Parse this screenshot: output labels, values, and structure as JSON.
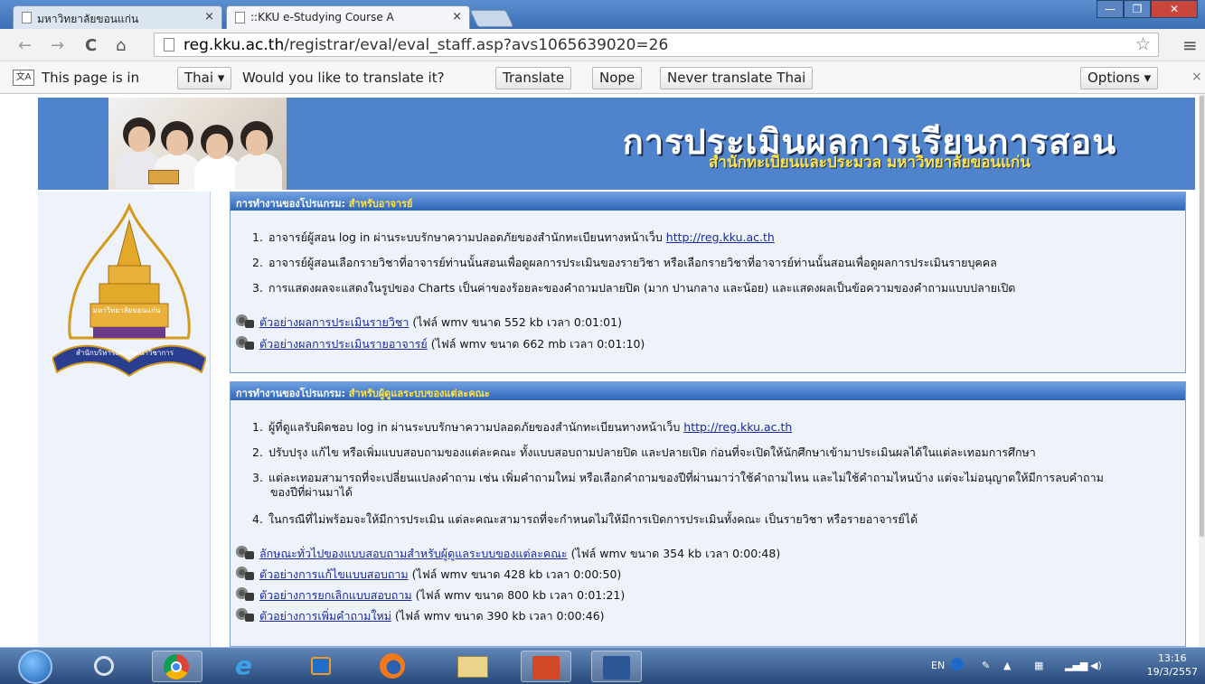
{
  "browser": {
    "tabs": [
      {
        "label": "มหาวิทยาลัยขอนแก่น",
        "close": "×"
      },
      {
        "label": "::KKU e-Studying Course A",
        "close": "×"
      }
    ],
    "window_buttons": {
      "minimize": "—",
      "maximize": "❐",
      "close": "✕"
    },
    "nav": {
      "back": "←",
      "forward": "→",
      "reload": "C",
      "home": "⌂",
      "star": "☆",
      "menu": "≡"
    },
    "url_host": "reg.kku.ac.th",
    "url_path": "/registrar/eval/eval_staff.asp?avs1065639020=26"
  },
  "translate_bar": {
    "prefix": "This page is in",
    "language": "Thai",
    "question": "Would you like to translate it?",
    "translate_btn": "Translate",
    "nope_btn": "Nope",
    "never_btn": "Never translate Thai",
    "options_btn": "Options",
    "close": "×"
  },
  "banner": {
    "title": "การประเมินผลการเรียนการสอน",
    "subtitle": "สำนักทะเบียนและประมวล มหาวิทยาลัยขอนแก่น"
  },
  "emblem": {
    "name_label": "มหาวิทยาลัยขอนแก่น",
    "ribbon": "สำนักบริหารและพัฒนาวิชาการ"
  },
  "panel1": {
    "head_prefix": "การทำงานของโปรแกรม:",
    "head_highlight": "สำหรับอาจารย์",
    "items": [
      {
        "num": "1.",
        "text": "อาจารย์ผู้สอน log in ผ่านระบบรักษาความปลอดภัยของสำนักทะเบียนทางหน้าเว็บ",
        "link": "http://reg.kku.ac.th"
      },
      {
        "num": "2.",
        "text": "อาจารย์ผู้สอนเลือกรายวิชาที่อาจารย์ท่านนั้นสอนเพื่อดูผลการประเมินของรายวิชา หรือเลือกรายวิชาที่อาจารย์ท่านนั้นสอนเพื่อดูผลการประเมินรายบุคคล"
      },
      {
        "num": "3.",
        "text": "การแสดงผลจะแสดงในรูปของ Charts เป็นค่าของร้อยละของคำถามปลายปิด (มาก ปานกลาง และน้อย) และแสดงผลเป็นข้อความของคำถามแบบปลายเปิด"
      }
    ],
    "videos": [
      {
        "link": "ตัวอย่างผลการประเมินรายวิชา",
        "info": "(ไฟล์ wmv ขนาด 552 kb เวลา 0:01:01)"
      },
      {
        "link": "ตัวอย่างผลการประเมินรายอาจารย์",
        "info": "(ไฟล์ wmv ขนาด 662 mb เวลา 0:01:10)"
      }
    ]
  },
  "panel2": {
    "head_prefix": "การทำงานของโปรแกรม:",
    "head_highlight": "สำหรับผู้ดูแลระบบของแต่ละคณะ",
    "items": [
      {
        "num": "1.",
        "text": "ผู้ที่ดูแลรับผิดชอบ log in ผ่านระบบรักษาความปลอดภัยของสำนักทะเบียนทางหน้าเว็บ",
        "link": "http://reg.kku.ac.th"
      },
      {
        "num": "2.",
        "text": "ปรับปรุง แก้ไข หรือเพิ่มแบบสอบถามของแต่ละคณะ ทั้งแบบสอบถามปลายปิด และปลายเปิด ก่อนที่จะเปิดให้นักศึกษาเข้ามาประเมินผลได้ในแต่ละเทอมการศึกษา"
      },
      {
        "num": "3.",
        "text": "แต่ละเทอมสามารถที่จะเปลี่ยนแปลงคำถาม เช่น เพิ่มคำถามใหม่ หรือเลือกคำถามของปีที่ผ่านมาว่าใช้คำถามไหน และไม่ใช้คำถามไหนบ้าง แต่จะไม่อนุญาตให้มีการลบคำถาม",
        "line2": "ของปีที่ผ่านมาได้"
      },
      {
        "num": "4.",
        "text": "ในกรณีที่ไม่พร้อมจะให้มีการประเมิน แต่ละคณะสามารถที่จะกำหนดไม่ให้มีการเปิดการประเมินทั้งคณะ เป็นรายวิชา หรือรายอาจารย์ได้"
      }
    ],
    "videos": [
      {
        "link": "ลักษณะทั่วไปของแบบสอบถามสำหรับผู้ดูแลระบบของแต่ละคณะ",
        "info": "(ไฟล์ wmv ขนาด 354 kb เวลา 0:00:48)"
      },
      {
        "link": "ตัวอย่างการแก้ไขแบบสอบถาม",
        "info": "(ไฟล์ wmv ขนาด 428 kb เวลา 0:00:50)"
      },
      {
        "link": "ตัวอย่างการยกเลิกแบบสอบถาม",
        "info": "(ไฟล์ wmv ขนาด 800 kb เวลา 0:01:21)"
      },
      {
        "link": "ตัวอย่างการเพิ่มคำถามใหม่",
        "info": "(ไฟล์ wmv ขนาด 390 kb เวลา 0:00:46)"
      }
    ]
  },
  "taskbar": {
    "icons": [
      "start-orb-icon",
      "media-center-icon",
      "chrome-icon",
      "internet-explorer-icon",
      "media-player-icon",
      "firefox-icon",
      "file-explorer-icon",
      "powerpoint-icon",
      "word-icon"
    ],
    "lang": "EN",
    "time": "13:16",
    "date": "19/3/2557"
  }
}
